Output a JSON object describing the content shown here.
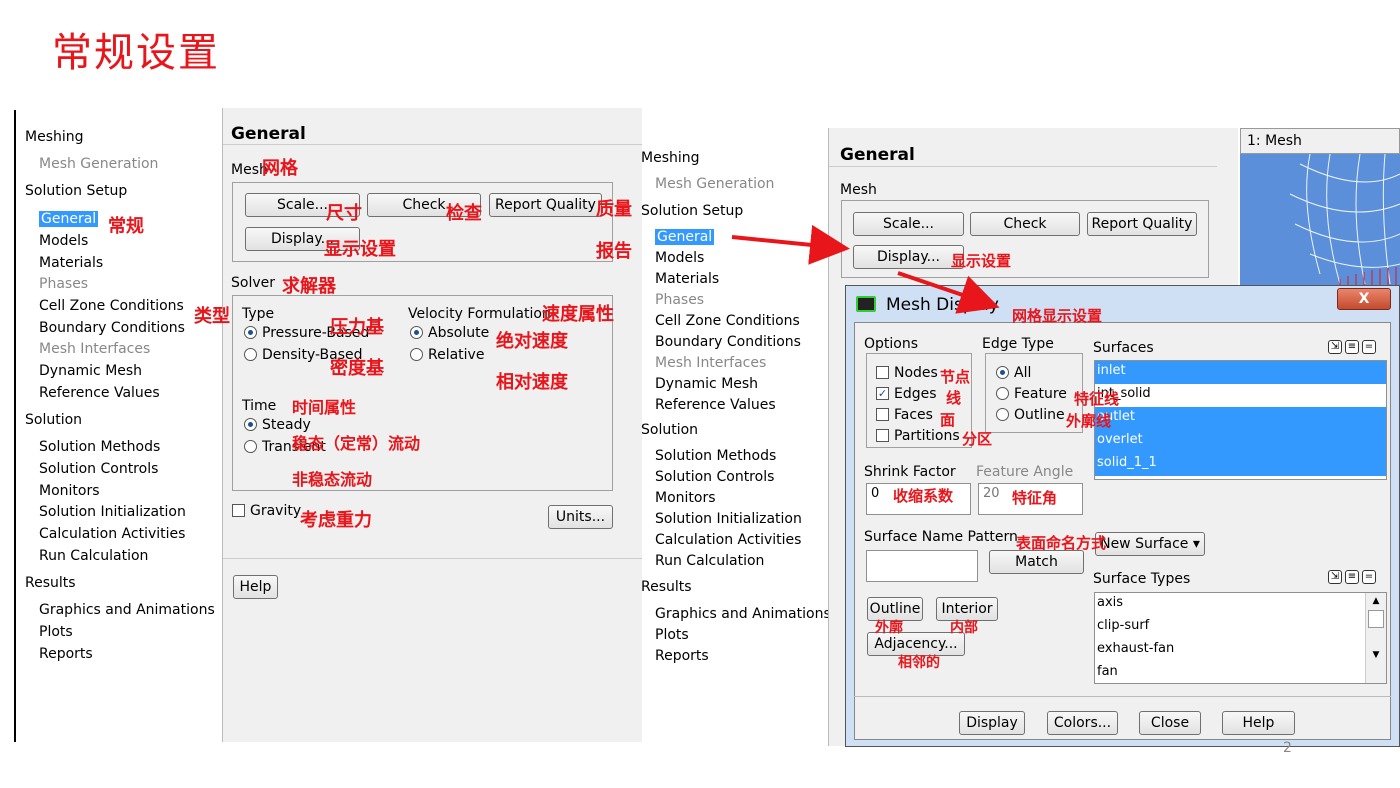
{
  "slide": {
    "title": "常规设置",
    "page_number": "2"
  },
  "left": {
    "tree": [
      {
        "label": "Meshing",
        "style": "head"
      },
      {
        "label": "Mesh Generation",
        "style": "grey"
      },
      {
        "label": "Solution Setup",
        "style": "head"
      },
      {
        "label": "General",
        "style": "selected"
      },
      {
        "label": "Models",
        "style": "child"
      },
      {
        "label": "Materials",
        "style": "child"
      },
      {
        "label": "Phases",
        "style": "grey"
      },
      {
        "label": "Cell Zone Conditions",
        "style": "child"
      },
      {
        "label": "Boundary Conditions",
        "style": "child"
      },
      {
        "label": "Mesh Interfaces",
        "style": "grey"
      },
      {
        "label": "Dynamic Mesh",
        "style": "child"
      },
      {
        "label": "Reference Values",
        "style": "child"
      },
      {
        "label": "Solution",
        "style": "head"
      },
      {
        "label": "Solution Methods",
        "style": "child"
      },
      {
        "label": "Solution Controls",
        "style": "child"
      },
      {
        "label": "Monitors",
        "style": "child"
      },
      {
        "label": "Solution Initialization",
        "style": "child"
      },
      {
        "label": "Calculation Activities",
        "style": "child"
      },
      {
        "label": "Run Calculation",
        "style": "child"
      },
      {
        "label": "Results",
        "style": "head"
      },
      {
        "label": "Graphics and Animations",
        "style": "child"
      },
      {
        "label": "Plots",
        "style": "child"
      },
      {
        "label": "Reports",
        "style": "child"
      }
    ],
    "general": {
      "title": "General",
      "mesh_label": "Mesh",
      "scale": "Scale...",
      "check": "Check",
      "report_quality": "Report Quality",
      "display": "Display...",
      "solver_label": "Solver",
      "type_label": "Type",
      "pressure_based": "Pressure-Based",
      "density_based": "Density-Based",
      "velocity_label": "Velocity Formulation",
      "absolute": "Absolute",
      "relative": "Relative",
      "time_label": "Time",
      "steady": "Steady",
      "transient": "Transient",
      "gravity": "Gravity",
      "units": "Units...",
      "help": "Help"
    },
    "notes": {
      "mesh": "网格",
      "general": "常规",
      "scale": "尺寸",
      "check": "检查",
      "quality": "质量",
      "display": "显示设置",
      "report": "报告",
      "solver": "求解器",
      "type": "类型",
      "pressure": "压力基",
      "velocity": "速度属性",
      "density": "密度基",
      "absolute": "绝对速度",
      "relative": "相对速度",
      "time": "时间属性",
      "steady": "稳态（定常）流动",
      "transient": "非稳态流动",
      "gravity": "考虑重力"
    }
  },
  "right": {
    "tree": [
      {
        "label": "Meshing",
        "style": "head"
      },
      {
        "label": "Mesh Generation",
        "style": "grey"
      },
      {
        "label": "Solution Setup",
        "style": "head"
      },
      {
        "label": "General",
        "style": "selected"
      },
      {
        "label": "Models",
        "style": "child"
      },
      {
        "label": "Materials",
        "style": "child"
      },
      {
        "label": "Phases",
        "style": "grey"
      },
      {
        "label": "Cell Zone Conditions",
        "style": "child"
      },
      {
        "label": "Boundary Conditions",
        "style": "child"
      },
      {
        "label": "Mesh Interfaces",
        "style": "grey"
      },
      {
        "label": "Dynamic Mesh",
        "style": "child"
      },
      {
        "label": "Reference Values",
        "style": "child"
      },
      {
        "label": "Solution",
        "style": "head"
      },
      {
        "label": "Solution Methods",
        "style": "child"
      },
      {
        "label": "Solution Controls",
        "style": "child"
      },
      {
        "label": "Monitors",
        "style": "child"
      },
      {
        "label": "Solution Initialization",
        "style": "child"
      },
      {
        "label": "Calculation Activities",
        "style": "child"
      },
      {
        "label": "Run Calculation",
        "style": "child"
      },
      {
        "label": "Results",
        "style": "head"
      },
      {
        "label": "Graphics and Animations",
        "style": "child"
      },
      {
        "label": "Plots",
        "style": "child"
      },
      {
        "label": "Reports",
        "style": "child"
      }
    ],
    "general": {
      "title": "General",
      "mesh_label": "Mesh",
      "scale": "Scale...",
      "check": "Check",
      "report_quality": "Report Quality",
      "display": "Display...",
      "display_note": "显示设置"
    },
    "mesh_view_tab": "1: Mesh",
    "dialog": {
      "title": "Mesh Display",
      "title_note": "网格显示设置",
      "close": "X",
      "options_label": "Options",
      "nodes": "Nodes",
      "edges": "Edges",
      "faces": "Faces",
      "partitions": "Partitions",
      "edges_checked": true,
      "edge_type_label": "Edge Type",
      "all": "All",
      "feature": "Feature",
      "outline": "Outline",
      "surfaces_label": "Surfaces",
      "surfaces": [
        {
          "name": "inlet",
          "selected": true
        },
        {
          "name": "int_solid",
          "selected": false
        },
        {
          "name": "outlet",
          "selected": true
        },
        {
          "name": "overlet",
          "selected": true
        },
        {
          "name": "solid_1_1",
          "selected": true
        }
      ],
      "shrink_label": "Shrink Factor",
      "shrink_value": "0",
      "feature_angle_label": "Feature Angle",
      "feature_angle_value": "20",
      "pattern_label": "Surface Name Pattern",
      "match": "Match",
      "new_surface": "New Surface",
      "surface_types_label": "Surface Types",
      "surface_types": [
        "axis",
        "clip-surf",
        "exhaust-fan",
        "fan"
      ],
      "outline_btn": "Outline",
      "interior_btn": "Interior",
      "adjacency_btn": "Adjacency...",
      "display_btn": "Display",
      "colors_btn": "Colors...",
      "close_btn": "Close",
      "help_btn": "Help"
    },
    "notes": {
      "nodes": "节点",
      "edges": "线",
      "faces": "面",
      "partitions": "分区",
      "feature": "特征线",
      "outline": "外廓线",
      "shrink": "收缩系数",
      "angle": "特征角",
      "pattern": "表面命名方式",
      "outline_btn": "外廓",
      "interior_btn": "内部",
      "adjacency": "相邻的"
    }
  },
  "colors": {
    "annotation": "#e8151b",
    "selection": "#3399ff"
  }
}
